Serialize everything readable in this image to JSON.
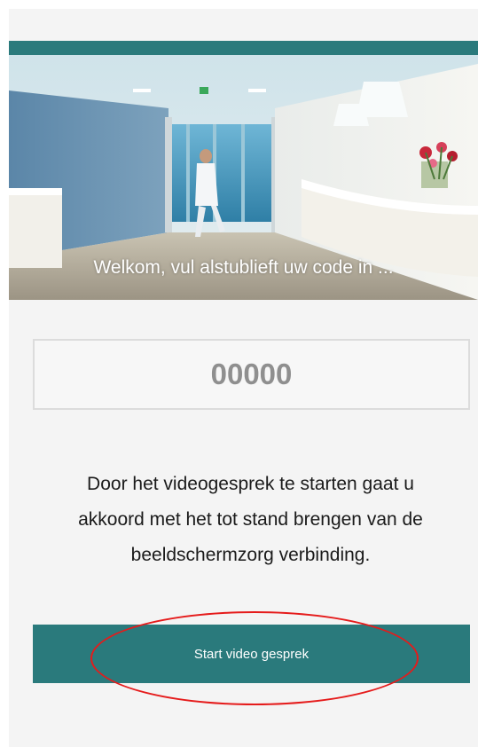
{
  "hero": {
    "caption": "Welkom, vul alstublieft uw code in ...",
    "image": "hospital-corridor-reception-photo"
  },
  "code_input": {
    "placeholder": "00000",
    "value": ""
  },
  "consent": {
    "line1": "Door het videogesprek te starten gaat u",
    "line2": "akkoord met het tot stand brengen van de",
    "line3": "beeldschermzorg verbinding."
  },
  "start_button": {
    "label": "Start video gesprek"
  },
  "colors": {
    "accent": "#2a7a7c",
    "annotation": "#e51b1b"
  }
}
